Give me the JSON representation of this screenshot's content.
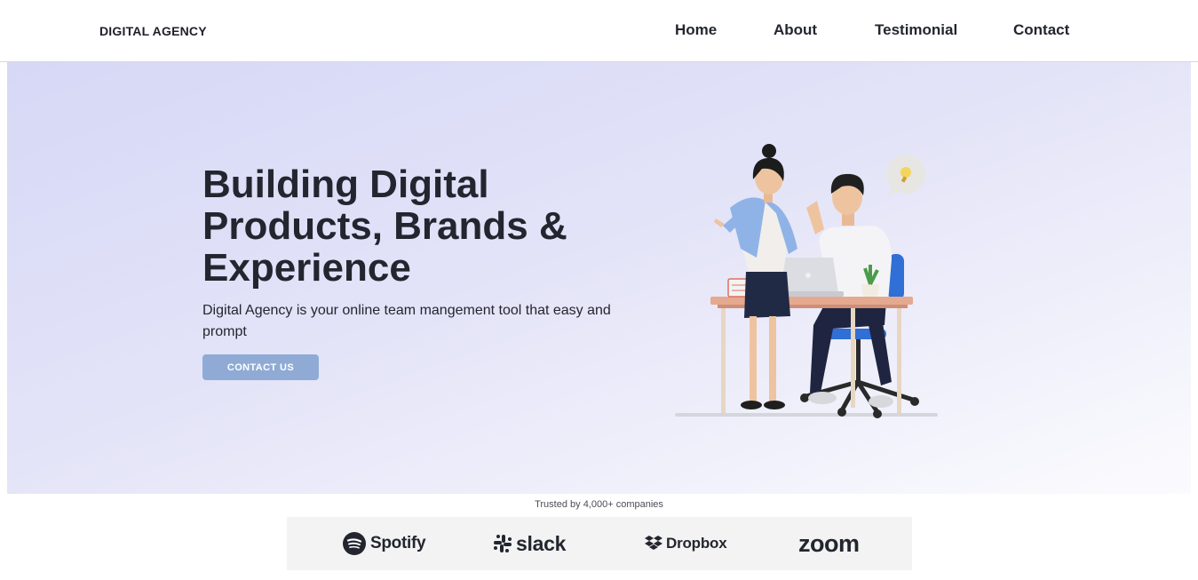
{
  "header": {
    "logo": "DIGITAL AGENCY",
    "nav": [
      "Home",
      "About",
      "Testimonial",
      "Contact"
    ]
  },
  "hero": {
    "title_lines": [
      "Building Digital",
      "Products, Brands &",
      "Experience"
    ],
    "description": "Digital Agency is your online team mangement tool that easy and prompt",
    "cta_label": "CONTACT US",
    "illustration_icon": "office-team-illustration"
  },
  "trusted": {
    "label": "Trusted by 4,000+ companies",
    "brands": [
      "Spotify",
      "slack",
      "Dropbox",
      "zoom"
    ]
  },
  "colors": {
    "text": "#23262f",
    "cta": "#8fabd5",
    "hero_gradient_start": "#d6d8f6",
    "hero_gradient_end": "#fbfbfe",
    "logo_strip_bg": "#f3f3f3"
  }
}
